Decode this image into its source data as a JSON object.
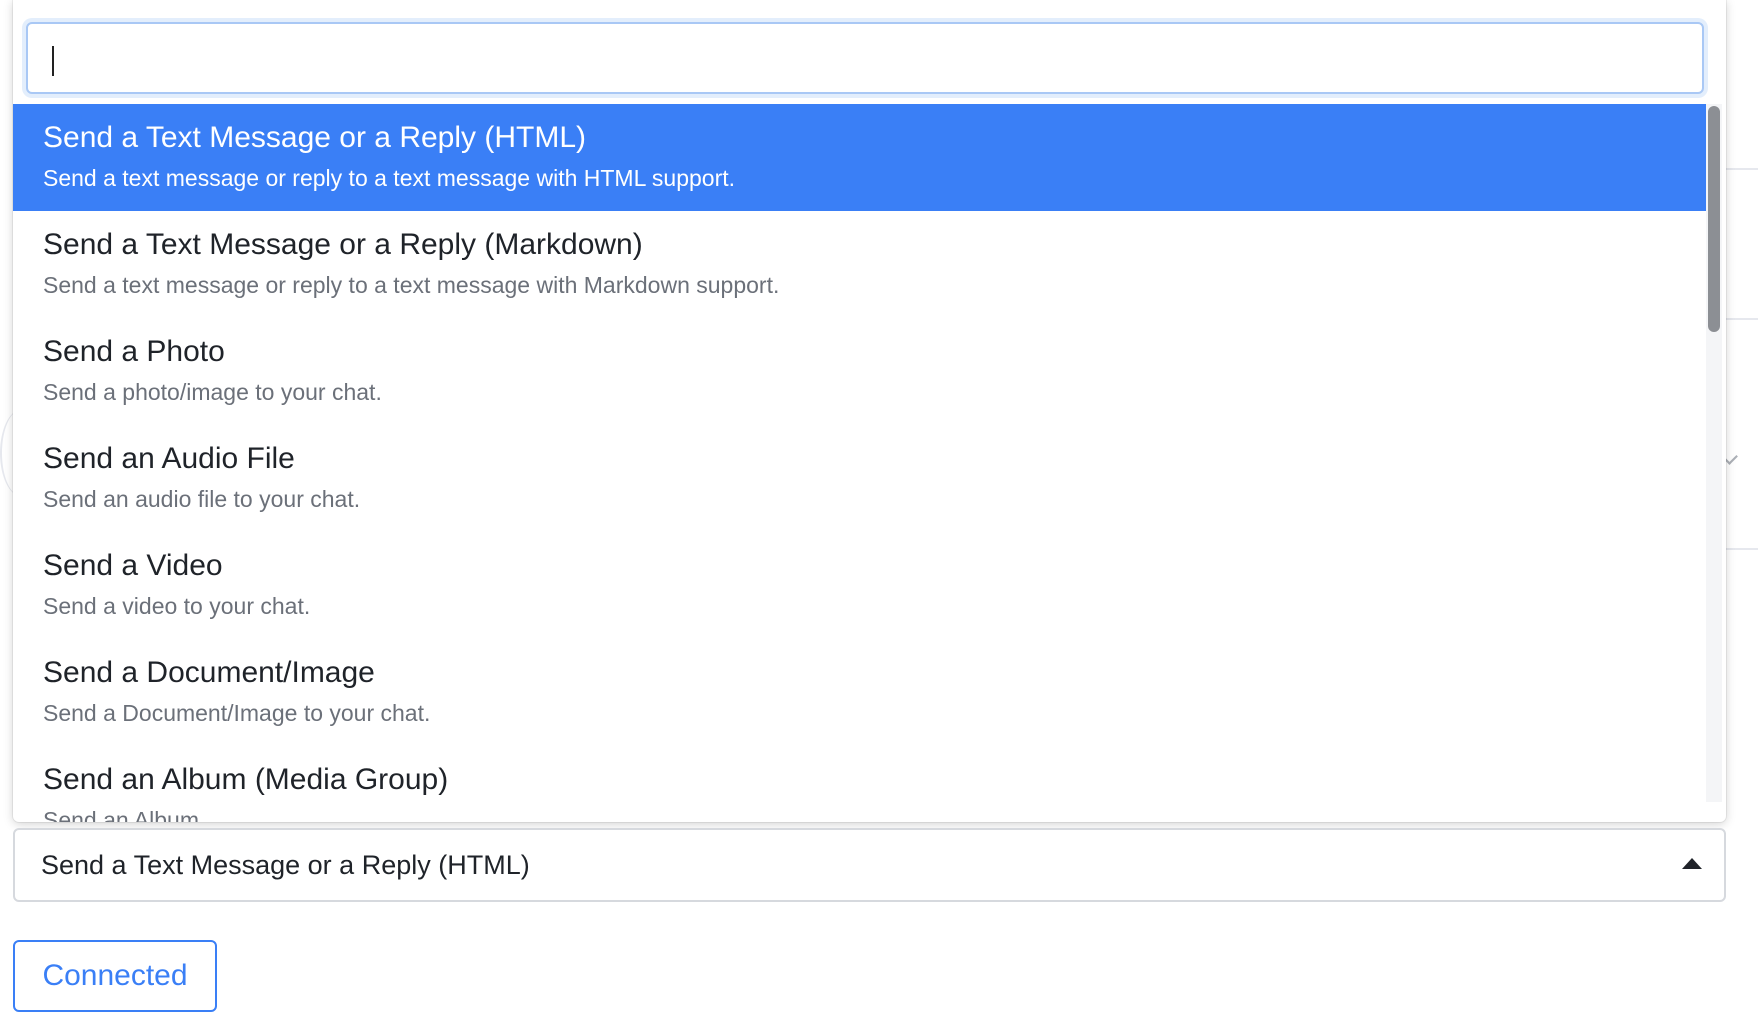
{
  "search": {
    "value": "",
    "placeholder": ""
  },
  "options": [
    {
      "title": "Send a Text Message or a Reply (HTML)",
      "description": "Send a text message or reply to a text message with HTML support.",
      "selected": true
    },
    {
      "title": "Send a Text Message or a Reply (Markdown)",
      "description": "Send a text message or reply to a text message with Markdown support.",
      "selected": false
    },
    {
      "title": "Send a Photo",
      "description": "Send a photo/image to your chat.",
      "selected": false
    },
    {
      "title": "Send an Audio File",
      "description": "Send an audio file to your chat.",
      "selected": false
    },
    {
      "title": "Send a Video",
      "description": "Send a video to your chat.",
      "selected": false
    },
    {
      "title": "Send a Document/Image",
      "description": "Send a Document/Image to your chat.",
      "selected": false
    },
    {
      "title": "Send an Album (Media Group)",
      "description": "Send an Album",
      "selected": false
    }
  ],
  "select": {
    "value": "Send a Text Message or a Reply (HTML)",
    "arrow_icon": "caret-up-icon"
  },
  "connection": {
    "label": "Connected"
  },
  "colors": {
    "accent": "#3a7ff6",
    "selected_text": "#ffffff",
    "title_text": "#1f2329",
    "description_text": "#6b7079",
    "border": "#d6d9de"
  }
}
